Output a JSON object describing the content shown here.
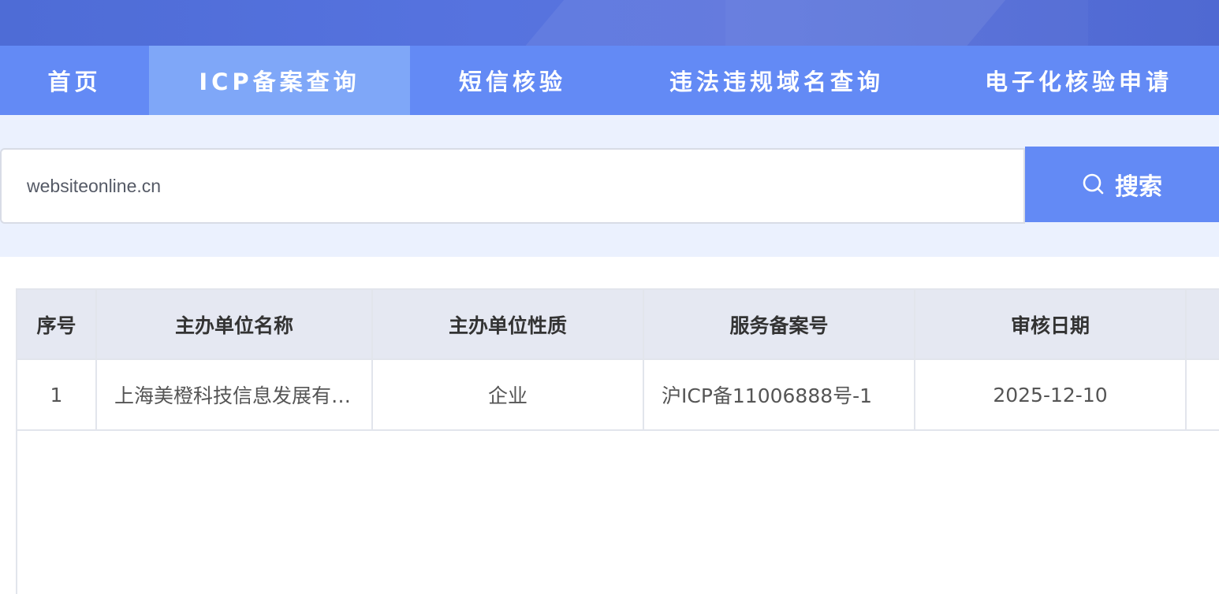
{
  "nav": {
    "items": [
      {
        "label": "首页"
      },
      {
        "label": "ICP备案查询"
      },
      {
        "label": "短信核验"
      },
      {
        "label": "违法违规域名查询"
      },
      {
        "label": "电子化核验申请"
      }
    ],
    "active_index": 1
  },
  "search": {
    "value": "websiteonline.cn",
    "button_label": "搜索",
    "icon": "search-icon"
  },
  "table": {
    "headers": [
      "序号",
      "主办单位名称",
      "主办单位性质",
      "服务备案号",
      "审核日期",
      ""
    ],
    "rows": [
      {
        "index": "1",
        "org_name": "上海美橙科技信息发展有限公司",
        "org_type": "企业",
        "record_no": "沪ICP备11006888号-1",
        "review_date": "2025-12-10",
        "extra": ""
      }
    ]
  },
  "colors": {
    "banner": "#5571dc",
    "nav_bg": "#638af5",
    "nav_active": "#7fa7f8",
    "search_band": "#ebf1fe",
    "button": "#638af5",
    "table_header": "#e5e8f2"
  }
}
